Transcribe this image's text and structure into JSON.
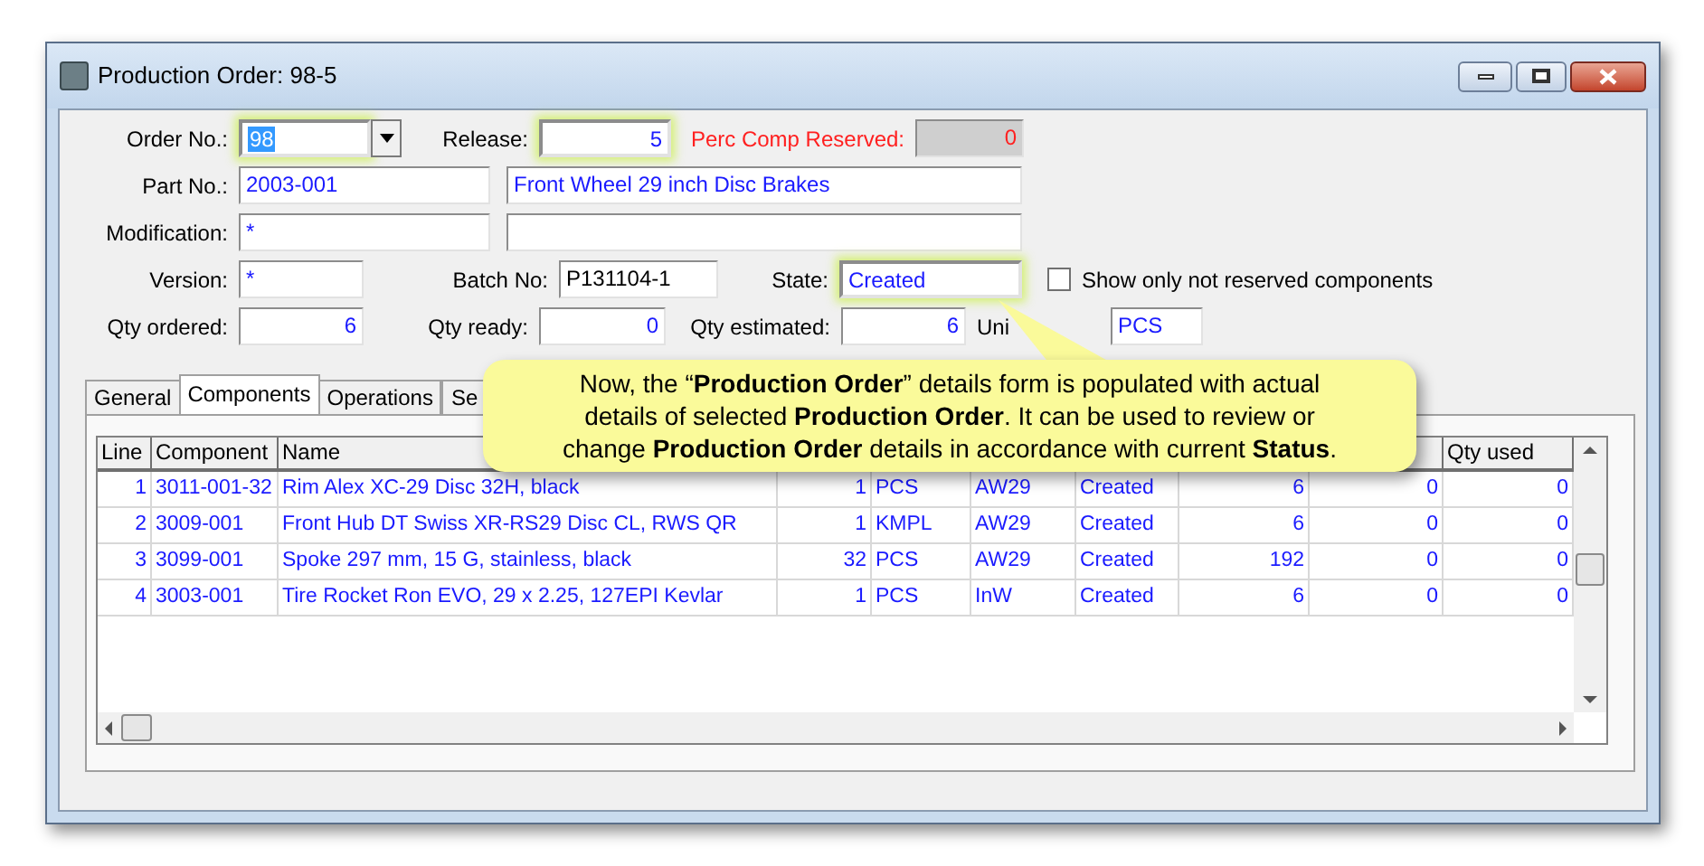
{
  "window": {
    "title": "Production Order: 98-5"
  },
  "form": {
    "order_no": {
      "label": "Order No.:",
      "value": "98"
    },
    "release": {
      "label": "Release:",
      "value": "5"
    },
    "perc_comp_reserved": {
      "label": "Perc Comp Reserved:",
      "value": "0"
    },
    "part_no": {
      "label": "Part No.:",
      "value": "2003-001",
      "description": "Front Wheel 29 inch Disc Brakes"
    },
    "modification": {
      "label": "Modification:",
      "value": "*"
    },
    "version": {
      "label": "Version:",
      "value": "*"
    },
    "batch_no": {
      "label": "Batch No:",
      "value": "P131104-1"
    },
    "state": {
      "label": "State:",
      "value": "Created"
    },
    "show_only_not_reserved": {
      "label": "Show only not reserved components",
      "checked": false
    },
    "qty_ordered": {
      "label": "Qty ordered:",
      "value": "6"
    },
    "qty_ready": {
      "label": "Qty ready:",
      "value": "0"
    },
    "qty_estimated": {
      "label": "Qty estimated:",
      "value": "6"
    },
    "unit": {
      "label": "Uni",
      "value": "PCS"
    }
  },
  "tabs": [
    {
      "label": "General",
      "selected": false
    },
    {
      "label": "Components",
      "selected": true
    },
    {
      "label": "Operations",
      "selected": false
    },
    {
      "label": "Se",
      "selected": false
    }
  ],
  "table": {
    "header": {
      "line": "Line",
      "component": "Component",
      "name": "Name",
      "qty_used": "Qty used"
    },
    "rows": [
      {
        "line": "1",
        "component": "3011-001-32",
        "name": "Rim Alex XC-29 Disc 32H, black",
        "qty": "1",
        "unit": "PCS",
        "column_6": "AW29",
        "state": "Created",
        "column_8": "6",
        "column_9": "0",
        "qty_used": "0"
      },
      {
        "line": "2",
        "component": "3009-001",
        "name": "Front Hub DT Swiss XR-RS29 Disc CL, RWS QR",
        "qty": "1",
        "unit": "KMPL",
        "column_6": "AW29",
        "state": "Created",
        "column_8": "6",
        "column_9": "0",
        "qty_used": "0"
      },
      {
        "line": "3",
        "component": "3099-001",
        "name": "Spoke 297 mm, 15 G, stainless, black",
        "qty": "32",
        "unit": "PCS",
        "column_6": "AW29",
        "state": "Created",
        "column_8": "192",
        "column_9": "0",
        "qty_used": "0"
      },
      {
        "line": "4",
        "component": "3003-001",
        "name": "Tire Rocket Ron EVO, 29 x 2.25, 127EPI Kevlar",
        "qty": "1",
        "unit": "PCS",
        "column_6": "InW",
        "state": "Created",
        "column_8": "6",
        "column_9": "0",
        "qty_used": "0"
      }
    ]
  },
  "callout": {
    "text": "Now, the “**Production Order**” details form is populated with actual details of selected **Production Order**. It can be used to review or change **Production Order** details in accordance with current **Status**."
  }
}
